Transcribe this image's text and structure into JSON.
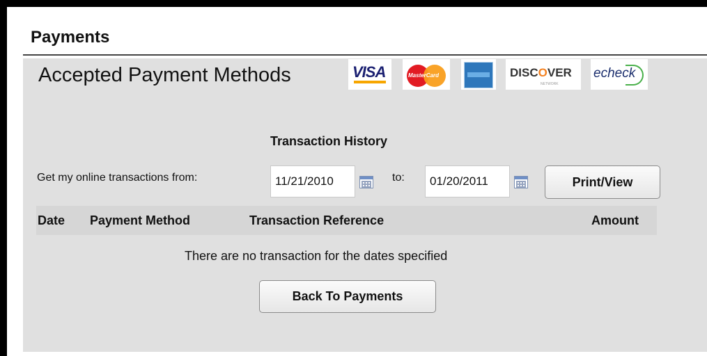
{
  "panel": {
    "title": "Payments"
  },
  "accepted": {
    "title": "Accepted Payment Methods",
    "cards": [
      {
        "icon": "visa-logo",
        "text": "VISA"
      },
      {
        "icon": "mastercard-logo",
        "text": "MasterCard"
      },
      {
        "icon": "amex-logo",
        "text": ""
      },
      {
        "icon": "discover-logo",
        "text": "DISCOVER"
      },
      {
        "icon": "echeck-logo",
        "text": "echeck"
      }
    ]
  },
  "transaction_history": {
    "title": "Transaction History",
    "from_label": "Get my online transactions from:",
    "from_date": "11/21/2010",
    "to_label": "to:",
    "to_date": "01/20/2011",
    "print_button": "Print/View",
    "calendar_icon": "calendar-icon",
    "columns": [
      "Date",
      "Payment Method",
      "Transaction Reference",
      "Amount"
    ],
    "empty_message": "There are no transaction for the dates specified",
    "back_button": "Back To Payments"
  },
  "colors": {
    "content_bg": "#e0e0e0",
    "header_row_bg": "#d6d6d6",
    "border": "#000000"
  }
}
